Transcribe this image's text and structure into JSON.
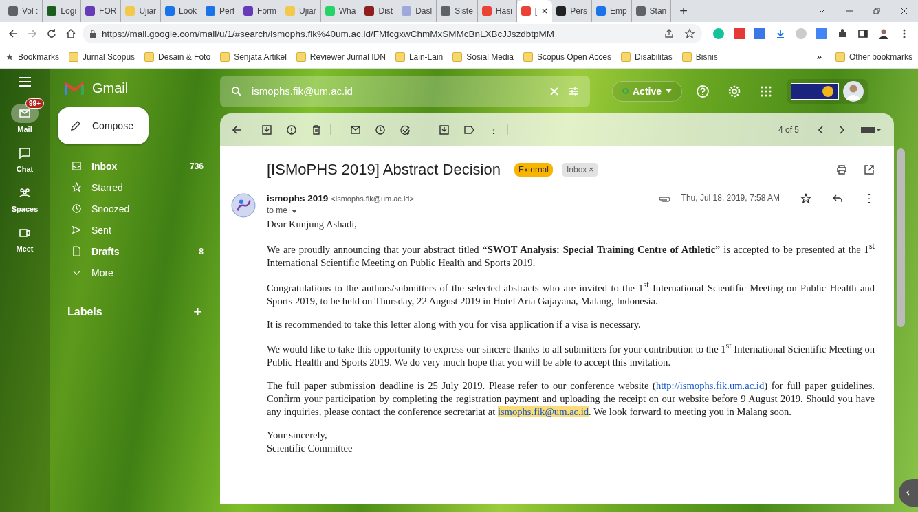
{
  "browser": {
    "tabs": [
      {
        "label": "Vol :",
        "selected": false
      },
      {
        "label": "Logi",
        "selected": false
      },
      {
        "label": "FOR",
        "selected": false
      },
      {
        "label": "Ujiar",
        "selected": false
      },
      {
        "label": "Look",
        "selected": false
      },
      {
        "label": "Perf",
        "selected": false
      },
      {
        "label": "Form",
        "selected": false
      },
      {
        "label": "Ujiar",
        "selected": false
      },
      {
        "label": "Wha",
        "selected": false
      },
      {
        "label": "Dist",
        "selected": false
      },
      {
        "label": "Dasl",
        "selected": false
      },
      {
        "label": "Siste",
        "selected": false
      },
      {
        "label": "Hasi",
        "selected": false
      },
      {
        "label": "[",
        "selected": true
      },
      {
        "label": "Pers",
        "selected": false
      },
      {
        "label": "Emp",
        "selected": false
      },
      {
        "label": "Stan",
        "selected": false
      }
    ],
    "new_tab": "+",
    "url": "https://mail.google.com/mail/u/1/#search/ismophs.fik%40um.ac.id/FMfcgxwChmMxSMMcBnLXBcJJszdbtpMM",
    "bookmarks_label": "Bookmarks",
    "bookmarks": [
      "Jurnal Scopus",
      "Desain & Foto",
      "Senjata Artikel",
      "Reviewer Jurnal IDN",
      "Lain-Lain",
      "Sosial Media",
      "Scopus Open Acces",
      "Disabilitas",
      "Bisnis"
    ],
    "bookmarks_overflow": "»",
    "other_bookmarks": "Other bookmarks"
  },
  "gmail": {
    "app_name": "Gmail",
    "rail": [
      {
        "label": "Mail",
        "selected": true,
        "badge": "99+"
      },
      {
        "label": "Chat",
        "selected": false
      },
      {
        "label": "Spaces",
        "selected": false
      },
      {
        "label": "Meet",
        "selected": false
      }
    ],
    "compose": "Compose",
    "folders": [
      {
        "label": "Inbox",
        "count": "736",
        "bold": true
      },
      {
        "label": "Starred",
        "bold": false
      },
      {
        "label": "Snoozed",
        "bold": false
      },
      {
        "label": "Sent",
        "bold": false
      },
      {
        "label": "Drafts",
        "count": "8",
        "bold": true
      },
      {
        "label": "More",
        "bold": false
      }
    ],
    "labels_heading": "Labels",
    "labels_add": "+",
    "search": {
      "value": "ismophs.fik@um.ac.id"
    },
    "status": "Active",
    "position": "4 of 5",
    "message": {
      "subject": "[ISMoPHS 2019] Abstract Decision",
      "tags": [
        {
          "label": "External",
          "kind": "external"
        },
        {
          "label": "Inbox",
          "kind": "label",
          "remove": "×"
        }
      ],
      "sender_name": "ismophs 2019",
      "sender_email": "<ismophs.fik@um.ac.id>",
      "recipient": "to me",
      "date": "Thu, Jul 18, 2019, 7:58 AM",
      "greeting": "Dear Kunjung Ashadi,",
      "paragraphs": [
        [
          {
            "kind": "text",
            "text": "We are proudly announcing that your abstract titled **“SWOT Analysis: Special Training Centre of Athletic”** is accepted to be presented at the 1$^{st}$ International Scientific Meeting on Public Health and Sports 2019."
          }
        ],
        [
          {
            "kind": "text",
            "text": "Congratulations to the authors/submitters of the selected abstracts who are invited to the 1$^{st}$ International Scientific Meeting on Public Health and Sports 2019, to be held on Thursday, 22 August 2019 in Hotel Aria Gajayana, Malang, Indonesia."
          }
        ],
        [
          {
            "kind": "text",
            "text": "It is recommended to take this letter along with you for visa application if a visa is necessary."
          }
        ],
        [
          {
            "kind": "text",
            "text": "We would like to take this opportunity to express our sincere thanks to all submitters for your contribution to the 1$^{st}$ International Scientific Meeting on Public Health and Sports 2019. We do very much hope that you will be able to accept this invitation."
          }
        ],
        [
          {
            "kind": "text",
            "text": "The full paper submission deadline is 25 July 2019. Please refer to our conference website ("
          },
          {
            "kind": "link",
            "text": "http://ismophs.fik.um.ac.id"
          },
          {
            "kind": "text",
            "text": ") for full paper guidelines. Confirm your participation by completing the registration payment and uploading the receipt on our website before 9 August 2019. Should you have any inquiries, please contact the conference secretariat at "
          },
          {
            "kind": "highlight",
            "text": "ismophs.fik@um.ac.id"
          },
          {
            "kind": "text",
            "text": ". We look forward to meeting you in Malang soon."
          }
        ]
      ],
      "signoff": [
        "Your sincerely,",
        "Scientific Committee"
      ]
    }
  }
}
